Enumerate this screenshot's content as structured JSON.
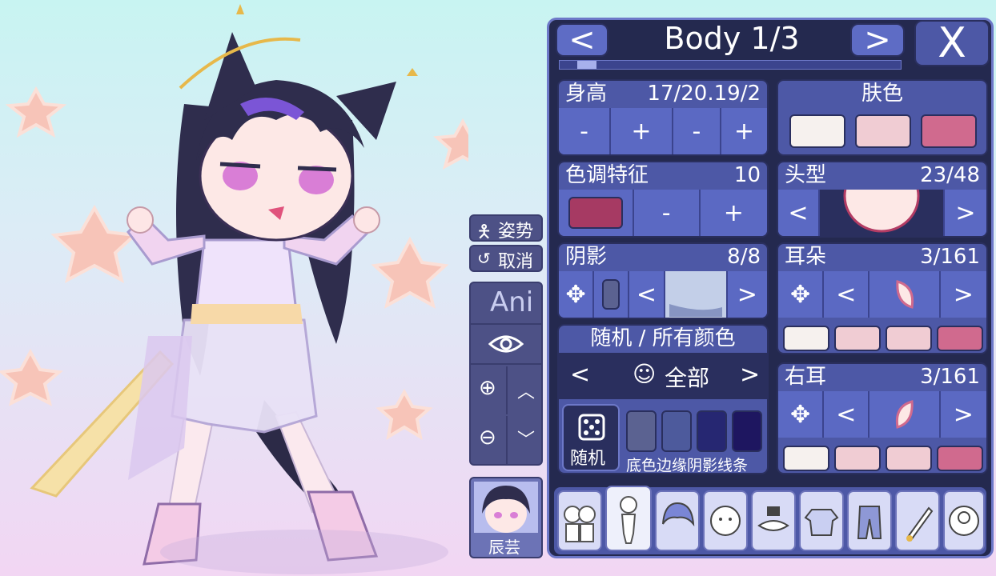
{
  "header": {
    "prev": "<",
    "title": "Body 1/3",
    "next": ">",
    "close": "X"
  },
  "side": {
    "pose_label": "姿势",
    "undo_label": "取消",
    "anim_label": "Ani",
    "preview_name": "辰芸"
  },
  "height_card": {
    "label": "身高",
    "value": "17/20.19/2",
    "btn_minus": "-",
    "btn_plus": "+"
  },
  "skin_card": {
    "label": "肤色",
    "colors": [
      "#f6f1ee",
      "#f0ccd3",
      "#d06a8e"
    ]
  },
  "tone_card": {
    "label": "色调特征",
    "value": "10",
    "color": "#a63a63",
    "btn_minus": "-",
    "btn_plus": "+"
  },
  "head_card": {
    "label": "头型",
    "value": "23/48",
    "prev": "<",
    "next": ">"
  },
  "shadow_card": {
    "label": "阴影",
    "value": "8/8",
    "prev": "<",
    "next": ">"
  },
  "ear_card": {
    "label": "耳朵",
    "value": "3/161",
    "prev": "<",
    "next": ">",
    "colors": [
      "#f6f1ee",
      "#f0ccd3",
      "#f0ccd3",
      "#d06a8e"
    ]
  },
  "right_ear_card": {
    "label": "右耳",
    "value": "3/161",
    "prev": "<",
    "next": ">",
    "colors": [
      "#f6f1ee",
      "#f0ccd3",
      "#f0ccd3",
      "#d06a8e"
    ]
  },
  "random_card": {
    "label": "随机 / 所有颜色",
    "prev": "<",
    "target": "全部",
    "next": ">",
    "random_label": "随机",
    "swatches": [
      "#5b6291",
      "#4d5a9c",
      "#262772",
      "#1e1660"
    ],
    "legend": "底色边缘阴影线条"
  },
  "tabs": [
    "people",
    "body",
    "hair",
    "face",
    "mask",
    "top",
    "bottom",
    "props",
    "head"
  ],
  "accent": "#5b69c3"
}
